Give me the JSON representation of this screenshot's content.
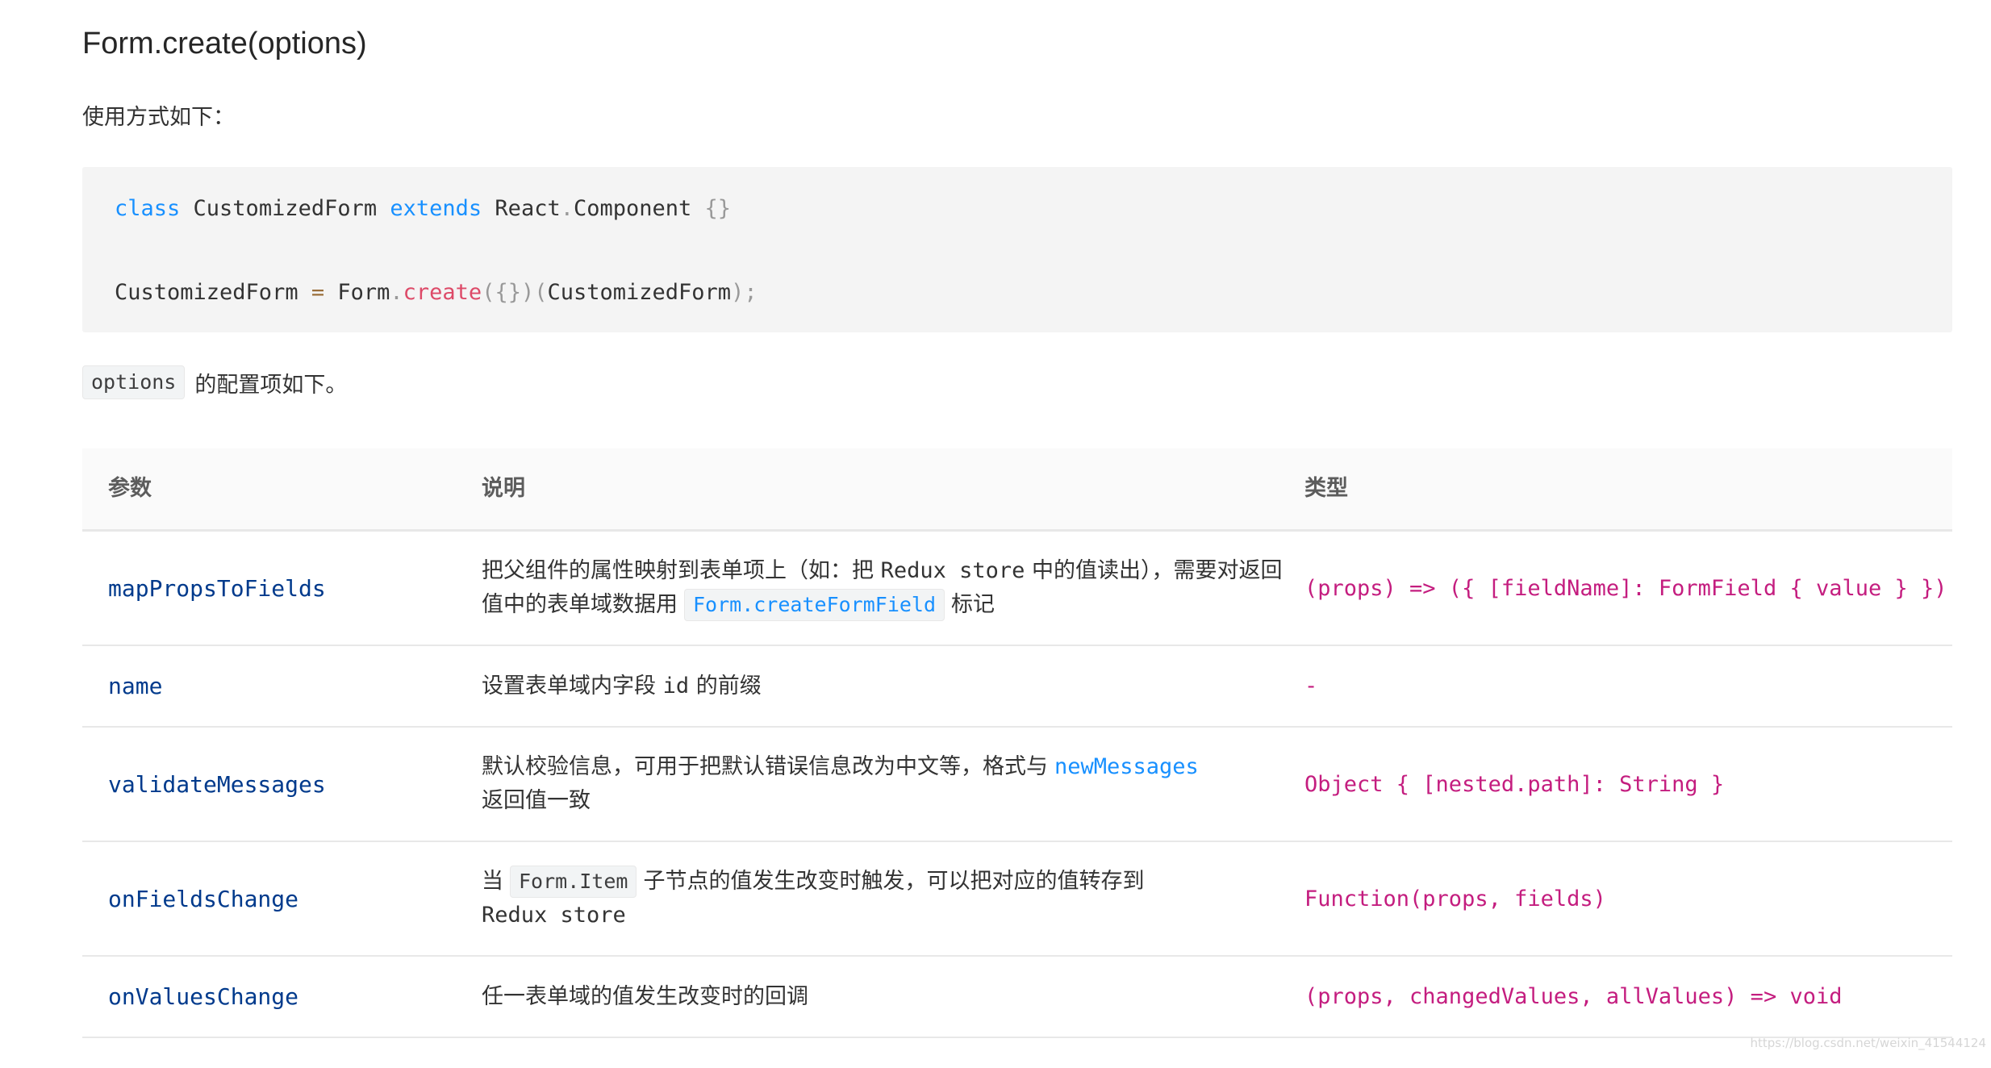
{
  "heading": "Form.create(options)",
  "intro": "使用方式如下：",
  "code": {
    "line1": {
      "kw1": "class",
      "name": " CustomizedForm ",
      "kw2": "extends",
      "rest1": " React",
      "dot": ".",
      "rest2": "Component ",
      "braces": "{}"
    },
    "line2": {
      "left": "CustomizedForm ",
      "eq": "=",
      "form": " Form",
      "dot": ".",
      "fn": "create",
      "args": "({})(",
      "arg": "CustomizedForm",
      "end": ");"
    }
  },
  "options_code": "options",
  "options_text": "的配置项如下。",
  "table": {
    "headers": [
      "参数",
      "说明",
      "类型"
    ],
    "rows": [
      {
        "param": "mapPropsToFields",
        "desc_a": "把父组件的属性映射到表单项上（如：把 ",
        "desc_mono": "Redux store",
        "desc_b": " 中的值读出），需要对返回值中的表单域数据用",
        "desc_code": "Form.createFormField",
        "desc_c": "标记",
        "type": "(props) => ({ [fieldName]: FormField { value } })"
      },
      {
        "param": "name",
        "desc_a": "设置表单域内字段 ",
        "desc_mono": "id",
        "desc_b": " 的前缀",
        "type": "-"
      },
      {
        "param": "validateMessages",
        "desc_a": "默认校验信息，可用于把默认错误信息改为中文等，格式与",
        "desc_link": "newMessages",
        "desc_b": "返回值一致",
        "type": "Object { [nested.path]: String }"
      },
      {
        "param": "onFieldsChange",
        "desc_a": "当",
        "desc_code": "Form.Item",
        "desc_b": "子节点的值发生改变时触发，可以把对应的值转存到",
        "desc_mono": "Redux store",
        "type": "Function(props, fields)"
      },
      {
        "param": "onValuesChange",
        "desc_a": "任一表单域的值发生改变时的回调",
        "type": "(props, changedValues, allValues) => void"
      }
    ]
  },
  "watermark": "https://blog.csdn.net/weixin_41544124"
}
